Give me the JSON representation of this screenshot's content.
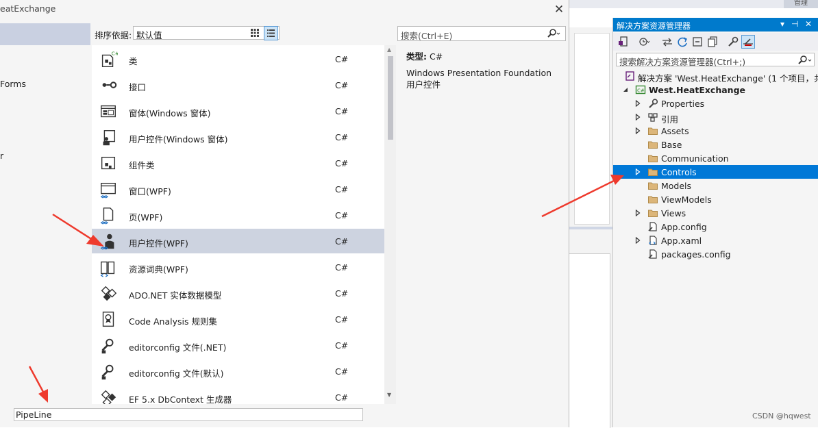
{
  "background": {
    "top_tab_text": "管理"
  },
  "dialog": {
    "title": "eatExchange",
    "close_glyph": "✕",
    "categories": [
      {
        "label": "",
        "selected": true
      },
      {
        "label": "Forms"
      },
      {
        "label": "r"
      }
    ],
    "sort_label": "排序依据:",
    "sort_value": "默认值",
    "search_placeholder": "搜索(Ctrl+E)",
    "templates": [
      {
        "name": "类",
        "lang": "C#",
        "icon": "class-icon"
      },
      {
        "name": "接口",
        "lang": "C#",
        "icon": "interface-icon"
      },
      {
        "name": "窗体(Windows 窗体)",
        "lang": "C#",
        "icon": "windows-form-icon"
      },
      {
        "name": "用户控件(Windows 窗体)",
        "lang": "C#",
        "icon": "winforms-user-control-icon"
      },
      {
        "name": "组件类",
        "lang": "C#",
        "icon": "component-class-icon"
      },
      {
        "name": "窗口(WPF)",
        "lang": "C#",
        "icon": "wpf-window-icon"
      },
      {
        "name": "页(WPF)",
        "lang": "C#",
        "icon": "wpf-page-icon"
      },
      {
        "name": "用户控件(WPF)",
        "lang": "C#",
        "icon": "wpf-user-control-icon",
        "selected": true
      },
      {
        "name": "资源词典(WPF)",
        "lang": "C#",
        "icon": "resource-dictionary-icon"
      },
      {
        "name": "ADO.NET 实体数据模型",
        "lang": "C#",
        "icon": "ado-net-icon"
      },
      {
        "name": "Code Analysis 规则集",
        "lang": "C#",
        "icon": "rule-set-icon"
      },
      {
        "name": "editorconfig 文件(.NET)",
        "lang": "C#",
        "icon": "editorconfig-net-icon"
      },
      {
        "name": "editorconfig 文件(默认)",
        "lang": "C#",
        "icon": "editorconfig-default-icon"
      },
      {
        "name": "EF 5.x DbContext 生成器",
        "lang": "C#",
        "icon": "ef-dbcontext-icon"
      }
    ],
    "detail": {
      "type_label": "类型:",
      "type_value": "C#",
      "description": "Windows Presentation Foundation 用户控件"
    },
    "name_value": "PipeLine"
  },
  "solution_explorer": {
    "title": "解决方案资源管理器",
    "title_buttons": [
      "▾",
      "⊣",
      "✕"
    ],
    "search_placeholder": "搜索解决方案资源管理器(Ctrl+;)",
    "tree": [
      {
        "label": "解决方案 'West.HeatExchange' (1 个项目，共 1",
        "depth": 0,
        "expander": "",
        "icon": "solution-icon"
      },
      {
        "label": "West.HeatExchange",
        "depth": 1,
        "expander": "expanded",
        "icon": "csharp-project-icon",
        "bold": true
      },
      {
        "label": "Properties",
        "depth": 2,
        "expander": "collapsed",
        "icon": "wrench-icon"
      },
      {
        "label": "引用",
        "depth": 2,
        "expander": "collapsed",
        "icon": "references-icon"
      },
      {
        "label": "Assets",
        "depth": 2,
        "expander": "collapsed",
        "icon": "folder-icon"
      },
      {
        "label": "Base",
        "depth": 2,
        "expander": "",
        "icon": "folder-icon"
      },
      {
        "label": "Communication",
        "depth": 2,
        "expander": "",
        "icon": "folder-icon"
      },
      {
        "label": "Controls",
        "depth": 2,
        "expander": "collapsed",
        "icon": "folder-icon",
        "selected": true
      },
      {
        "label": "Models",
        "depth": 2,
        "expander": "",
        "icon": "folder-icon"
      },
      {
        "label": "ViewModels",
        "depth": 2,
        "expander": "",
        "icon": "folder-icon"
      },
      {
        "label": "Views",
        "depth": 2,
        "expander": "collapsed",
        "icon": "folder-icon"
      },
      {
        "label": "App.config",
        "depth": 2,
        "expander": "",
        "icon": "config-file-icon"
      },
      {
        "label": "App.xaml",
        "depth": 2,
        "expander": "collapsed",
        "icon": "xaml-file-icon"
      },
      {
        "label": "packages.config",
        "depth": 2,
        "expander": "",
        "icon": "config-file-icon"
      }
    ]
  },
  "watermark": "CSDN @hqwest",
  "colors": {
    "accent": "#007acc",
    "selection": "#0078d7",
    "annotation_arrow": "#ee3a2d"
  }
}
